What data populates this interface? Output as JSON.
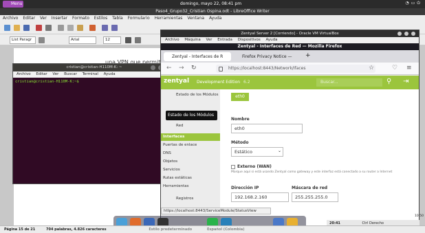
{
  "host": {
    "menu_label": "Menu",
    "clock": "domingo, mayo 22, 08:41 pm",
    "tray_icons": [
      "wifi-icon",
      "battery-icon",
      "power-icon"
    ]
  },
  "writer": {
    "title": "Paso4_Grupo32_Cristian Ospina.odt - LibreOffice Writer",
    "menu": [
      "Archivo",
      "Editar",
      "Ver",
      "Insertar",
      "Formato",
      "Estilos",
      "Tabla",
      "Formulario",
      "Herramientas",
      "Ventana",
      "Ayuda"
    ],
    "para_style": "List Paragr",
    "font_name": "Arial",
    "font_size": "12",
    "doc_text": "una VPN que permita",
    "status": {
      "page": "Página 15 de 21",
      "words": "704 palabras, 4.826 caracteres",
      "style": "Estilo predeterminado",
      "lang": "Español (Colombia)"
    }
  },
  "terminal": {
    "title": "cristian@cristian-H110M-K: ~",
    "menu": [
      "Archivo",
      "Editar",
      "Ver",
      "Buscar",
      "Terminal",
      "Ayuda"
    ],
    "prompt": "cristian@cristian-H110M-K:~$"
  },
  "vbox": {
    "title": "Zentyal Server 2 [Corriendo] - Oracle VM VirtualBox",
    "menu": [
      "Archivo",
      "Máquina",
      "Ver",
      "Entrada",
      "Dispositivos",
      "Ayuda"
    ]
  },
  "firefox": {
    "title": "Zentyal - Interfaces de Red — Mozilla Firefox",
    "tabs": [
      "Zentyal - Interfaces de R",
      "Firefox Privacy Notice —"
    ],
    "new_tab": "+",
    "url": "https://localhost:8443/Network/Ifaces",
    "status_url": "https://localhost:8443/ServiceModule/StatusView"
  },
  "zentyal": {
    "logo": "zentyal",
    "edition": "Development Edition",
    "version": "6.2",
    "search_placeholder": "Buscar...",
    "side": {
      "dashboard": "Estado de los Módulos",
      "tooltip": "Estado de los Módulos",
      "red": "Red",
      "items": [
        "Interfaces",
        "Puertas de enlace",
        "DNS",
        "Objetos",
        "Servicios",
        "Rutas estáticas",
        "Herramientas"
      ],
      "registros": "Registros"
    },
    "tab_active": "eth0",
    "form": {
      "nombre_label": "Nombre",
      "nombre_value": "eth0",
      "metodo_label": "Método",
      "metodo_value": "Estático",
      "externo_label": "Externo (WAN)",
      "externo_help": "Marque aquí si está usando Zentyal como gateway y este interfaz está conectado a su router a Internet",
      "ip_label": "Dirección IP",
      "ip_value": "192.168.2.160",
      "mask_label": "Máscara de red",
      "mask_value": "255.255.255.0"
    }
  },
  "vm_tray": {
    "time": "20:41",
    "ctrl": "Ctrl Derecho"
  },
  "host_side_time": "10:50"
}
